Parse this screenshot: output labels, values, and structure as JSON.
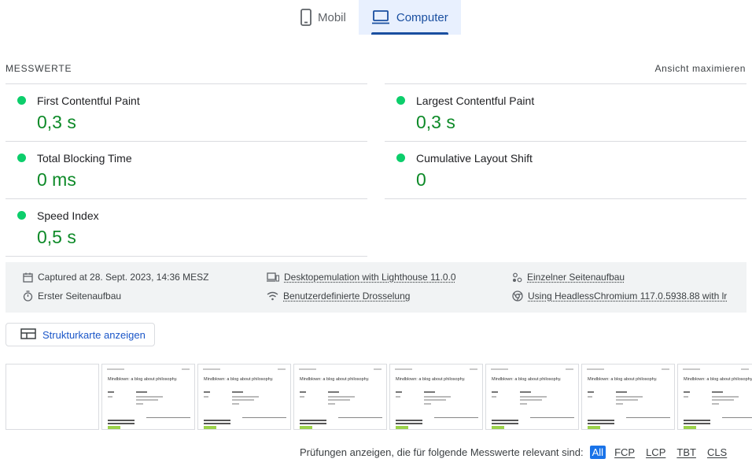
{
  "device_tabs": [
    {
      "label": "Mobil",
      "icon": "smartphone-icon",
      "active": false
    },
    {
      "label": "Computer",
      "icon": "laptop-icon",
      "active": true
    }
  ],
  "metrics_section": {
    "title": "MESSWERTE",
    "maximize_label": "Ansicht maximieren"
  },
  "metrics": [
    {
      "label": "First Contentful Paint",
      "value": "0,3 s",
      "status": "good"
    },
    {
      "label": "Largest Contentful Paint",
      "value": "0,3 s",
      "status": "good"
    },
    {
      "label": "Total Blocking Time",
      "value": "0 ms",
      "status": "good"
    },
    {
      "label": "Cumulative Layout Shift",
      "value": "0",
      "status": "good"
    },
    {
      "label": "Speed Index",
      "value": "0,5 s",
      "status": "good"
    }
  ],
  "run_info": {
    "captured": "Captured at 28. Sept. 2023, 14:36 MESZ",
    "initial_load": "Erster Seitenaufbau",
    "emulation": "Desktopemulation with Lighthouse 11.0.0",
    "throttling": "Benutzerdefinierte Drosselung",
    "single_load": "Einzelner Seitenaufbau",
    "browser": "Using HeadlessChromium 117.0.5938.88 with lr"
  },
  "treemap_button": {
    "label": "Strukturkarte anzeigen"
  },
  "filmstrip": {
    "frame_title": "Mindblown: a blog about philosophy."
  },
  "audit_filter": {
    "label": "Prüfungen anzeigen, die für folgende Messwerte relevant sind:",
    "options": [
      "All",
      "FCP",
      "LCP",
      "TBT",
      "CLS"
    ],
    "selected": "All"
  },
  "colors": {
    "good": "#0cce6b",
    "good_text": "#0d8a28",
    "accent": "#1a73e8",
    "tab_active_bg": "#e8f0fe"
  }
}
